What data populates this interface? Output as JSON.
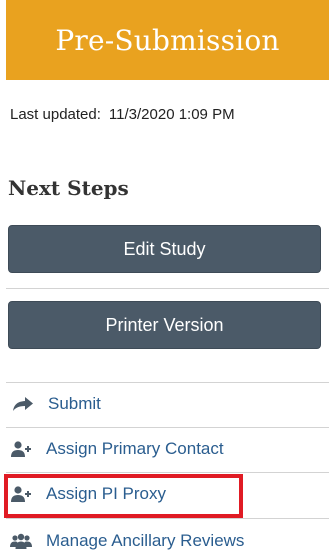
{
  "state": {
    "title": "Pre-Submission"
  },
  "last_updated": {
    "label": "Last updated:",
    "value": "11/3/2020 1:09 PM"
  },
  "next_steps": {
    "heading": "Next Steps",
    "buttons": {
      "edit_study": "Edit Study",
      "printer_version": "Printer Version"
    },
    "actions": [
      {
        "label": "Submit",
        "icon": "share-arrow-icon"
      },
      {
        "label": "Assign Primary Contact",
        "icon": "add-user-icon"
      },
      {
        "label": "Assign PI Proxy",
        "icon": "add-user-icon"
      },
      {
        "label": "Manage Ancillary Reviews",
        "icon": "users-group-icon"
      }
    ]
  },
  "colors": {
    "banner": "#e9a21f",
    "button": "#4b5a68",
    "link": "#2a5d8f",
    "icon": "#4b5a68",
    "highlight": "#e01b24"
  }
}
